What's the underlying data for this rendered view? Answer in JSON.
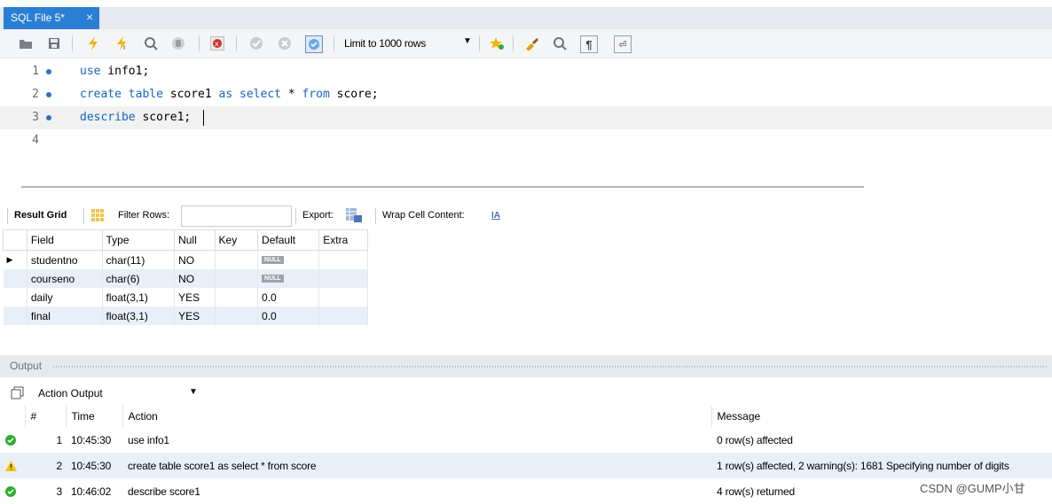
{
  "tab": {
    "title": "SQL File 5*",
    "close": "×"
  },
  "toolbar": {
    "limit_label": "Limit to 1000 rows"
  },
  "editor": {
    "lines": [
      {
        "num": "1",
        "kw1": "use",
        "rest1": " info1;",
        "kw2": "",
        "rest2": "",
        "kw3": "",
        "rest3": ""
      },
      {
        "num": "2",
        "kw1": "create table",
        "rest1": " score1 ",
        "kw2": "as select",
        "rest2": " * ",
        "kw3": "from",
        "rest3": " score;"
      },
      {
        "num": "3",
        "kw1": "describe",
        "rest1": " score1;",
        "kw2": "",
        "rest2": "",
        "kw3": "",
        "rest3": ""
      },
      {
        "num": "4",
        "kw1": "",
        "rest1": "",
        "kw2": "",
        "rest2": "",
        "kw3": "",
        "rest3": ""
      }
    ]
  },
  "result_toolbar": {
    "result_grid": "Result Grid",
    "filter_rows": "Filter Rows:",
    "export": "Export:",
    "wrap": "Wrap Cell Content:"
  },
  "grid": {
    "columns": [
      "Field",
      "Type",
      "Null",
      "Key",
      "Default",
      "Extra"
    ],
    "rows": [
      {
        "field": "studentno",
        "type": "char(11)",
        "null": "NO",
        "key": "",
        "default": "NULL",
        "extra": ""
      },
      {
        "field": "courseno",
        "type": "char(6)",
        "null": "NO",
        "key": "",
        "default": "NULL",
        "extra": ""
      },
      {
        "field": "daily",
        "type": "float(3,1)",
        "null": "YES",
        "key": "",
        "default": "0.0",
        "extra": ""
      },
      {
        "field": "final",
        "type": "float(3,1)",
        "null": "YES",
        "key": "",
        "default": "0.0",
        "extra": ""
      }
    ]
  },
  "output": {
    "title": "Output",
    "selector": "Action Output",
    "columns": [
      "#",
      "Time",
      "Action",
      "Message"
    ],
    "rows": [
      {
        "status": "ok",
        "num": "1",
        "time": "10:45:30",
        "action": "use info1",
        "message": "0 row(s) affected"
      },
      {
        "status": "warn",
        "num": "2",
        "time": "10:45:30",
        "action": "create table score1 as select * from score",
        "message": "1 row(s) affected, 2 warning(s): 1681 Specifying number of digits"
      },
      {
        "status": "ok",
        "num": "3",
        "time": "10:46:02",
        "action": "describe score1",
        "message": "4 row(s) returned"
      }
    ]
  },
  "watermark": "CSDN @GUMP小甘",
  "colors": {
    "tab": "#2a7fd4",
    "keyword": "#1565c0",
    "ok": "#2eae2e",
    "warn": "#f2c200",
    "row_alt": "#e9eff9"
  }
}
